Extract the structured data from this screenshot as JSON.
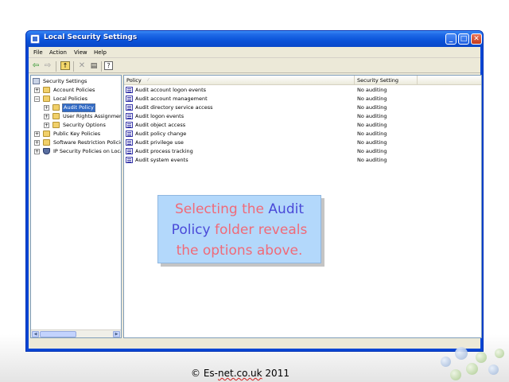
{
  "window": {
    "title": "Local Security Settings",
    "controls": {
      "minimize": "_",
      "maximize": "□",
      "close": "✕"
    }
  },
  "menu": [
    "File",
    "Action",
    "View",
    "Help"
  ],
  "toolbar": {
    "icons": [
      "back-arrow-icon",
      "forward-arrow-icon",
      "up-folder-icon",
      "delete-icon",
      "properties-icon",
      "help-icon"
    ]
  },
  "tree": {
    "items": [
      {
        "label": "Security Settings",
        "icon": "security-settings-icon",
        "expander": ""
      },
      {
        "label": "Account Policies",
        "icon": "folder-icon",
        "expander": "+"
      },
      {
        "label": "Local Policies",
        "icon": "folder-icon",
        "expander": "−"
      },
      {
        "label": "Audit Policy",
        "icon": "folder-icon",
        "expander": "+",
        "selected": true
      },
      {
        "label": "User Rights Assignmen",
        "icon": "folder-icon",
        "expander": "+"
      },
      {
        "label": "Security Options",
        "icon": "folder-icon",
        "expander": "+"
      },
      {
        "label": "Public Key Policies",
        "icon": "folder-icon",
        "expander": "+"
      },
      {
        "label": "Software Restriction Policie",
        "icon": "folder-icon",
        "expander": "+"
      },
      {
        "label": "IP Security Policies on Loca",
        "icon": "shield-icon",
        "expander": "+"
      }
    ]
  },
  "list": {
    "columns": {
      "policy": "Policy",
      "setting": "Security Setting"
    },
    "rows": [
      {
        "policy": "Audit account logon events",
        "setting": "No auditing"
      },
      {
        "policy": "Audit account management",
        "setting": "No auditing"
      },
      {
        "policy": "Audit directory service access",
        "setting": "No auditing"
      },
      {
        "policy": "Audit logon events",
        "setting": "No auditing"
      },
      {
        "policy": "Audit object access",
        "setting": "No auditing"
      },
      {
        "policy": "Audit policy change",
        "setting": "No auditing"
      },
      {
        "policy": "Audit privilege use",
        "setting": "No auditing"
      },
      {
        "policy": "Audit process tracking",
        "setting": "No auditing"
      },
      {
        "policy": "Audit system events",
        "setting": "No auditing"
      }
    ]
  },
  "callout": {
    "line1_a": "Selecting the ",
    "line1_b": "Audit",
    "line2_a": "Policy",
    "line2_b": " folder reveals",
    "line3": "the options above.",
    "colors": {
      "pink": "#f06a78",
      "blue": "#4a4ad8",
      "background": "#b3d8fb"
    }
  },
  "footer": {
    "copyright_prefix": "© Es-",
    "copyright_domain": "net.co.uk",
    "copyright_year": " 2011"
  },
  "colors": {
    "titlebar": "#0a52d8",
    "selection": "#316ac5",
    "window_bg": "#ece9d8"
  }
}
